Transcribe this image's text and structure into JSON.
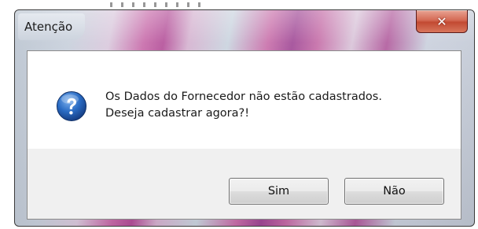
{
  "dialog": {
    "title": "Atenção",
    "close_label": "✕",
    "icon": "help-question-icon",
    "message_line1": "Os Dados do Fornecedor não estão cadastrados.",
    "message_line2": "Deseja cadastrar agora?!",
    "buttons": {
      "yes_label": "Sim",
      "no_label": "Não"
    }
  },
  "colors": {
    "close_button": "#c94e36",
    "icon_blue": "#1f5fb4",
    "content_bg": "#ffffff",
    "button_bar_bg": "#f0f0f0"
  }
}
